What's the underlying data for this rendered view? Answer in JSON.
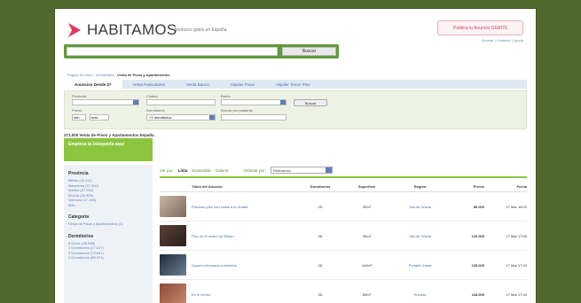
{
  "colors": {
    "background": "#4f6a2c",
    "brand_pink": "#e63762",
    "search_green": "#5f9b3a",
    "accent_green": "#8cc63f",
    "link_blue": "#4a6ea5"
  },
  "header": {
    "logo_text": "HABITAMOS",
    "tagline": "Anuncios gratis en España",
    "publish_button": "Publica tu Anuncio GRATIS",
    "top_links": "Accede | Contacto | Ayuda"
  },
  "search": {
    "placeholder": "",
    "button_label": "Buscar"
  },
  "breadcrumb": {
    "links": "Página de Inicio › Inmobiliaria ›",
    "current": "Venta de Pisos y Apartamentos"
  },
  "tabs": [
    {
      "label": "Anuncios Desde 27"
    },
    {
      "label": "Venta Particulares"
    },
    {
      "label": "Venta Banco"
    },
    {
      "label": "Alquiler Pisos"
    },
    {
      "label": "Alquiler Tercer Piso"
    }
  ],
  "filters": {
    "provincia_label": "Provincia",
    "ciudad_label": "Ciudad",
    "barrio_label": "Barrio",
    "precio_label": "Precio",
    "dormitorios_label": "Dormitorios",
    "keywords_label": "Buscar por palabras",
    "min_value": "min",
    "max_value": "máx",
    "dormitorios_value": "+1 dormitorios",
    "search_button": "Buscar"
  },
  "results_title": "271.000 Venta de Pisos y Apartamentos España",
  "green_box": "Empieza tu búsqueda aquí",
  "sidebar": {
    "provincia_title": "Provincia",
    "provincias": [
      "Bilbao (42.111)",
      "Barcelona (27.000)",
      "Madrid (27.224)",
      "Murcia (26.300)",
      "Valencia (17.198)",
      "Más..."
    ],
    "categoria_title": "Categoría",
    "categorias": [
      "Venta de Pisos y Apartamentos (1)"
    ],
    "dormitorios_title": "Dormitorios",
    "dormitorios": [
      "0 Dorm. (26.666)",
      "1 Dormitorios (27.647)",
      "2 Dormitorios (73.841)",
      "3 Dormitorios (88.371)"
    ]
  },
  "view": {
    "label": "Ver por:",
    "options": [
      "Lista",
      "Expandida",
      "Galería"
    ],
    "sort_label": "Ordenar por:",
    "sort_value": "Relevancia"
  },
  "table": {
    "columns": [
      "Título del Anuncio",
      "Dormitorios",
      "Superficie",
      "Región",
      "Precio",
      "Fecha"
    ],
    "rows": [
      {
        "title": "Precioso piso con vistas a la ciudad",
        "dorm": "2D",
        "sup": "90m²",
        "region": "Vila de Gracia",
        "price": "89.000",
        "date": "17 Mar 16:20"
      },
      {
        "title": "Piso en el centro de Bilbao",
        "dorm": "3D",
        "sup": "95m²",
        "region": "Vila de Gràcia",
        "price": "120.000",
        "date": "17 Mar 17:06"
      },
      {
        "title": "Duplex reformado a estrenar",
        "dorm": "3D",
        "sup": "140m²",
        "region": "Portalet Juana",
        "price": "135.000",
        "date": "17 Mar 17:20"
      },
      {
        "title": "En el centro",
        "dorm": "3D",
        "sup": "85m²",
        "region": "Huertas",
        "price": "118.000",
        "date": "17 Mar 17:40"
      }
    ]
  }
}
